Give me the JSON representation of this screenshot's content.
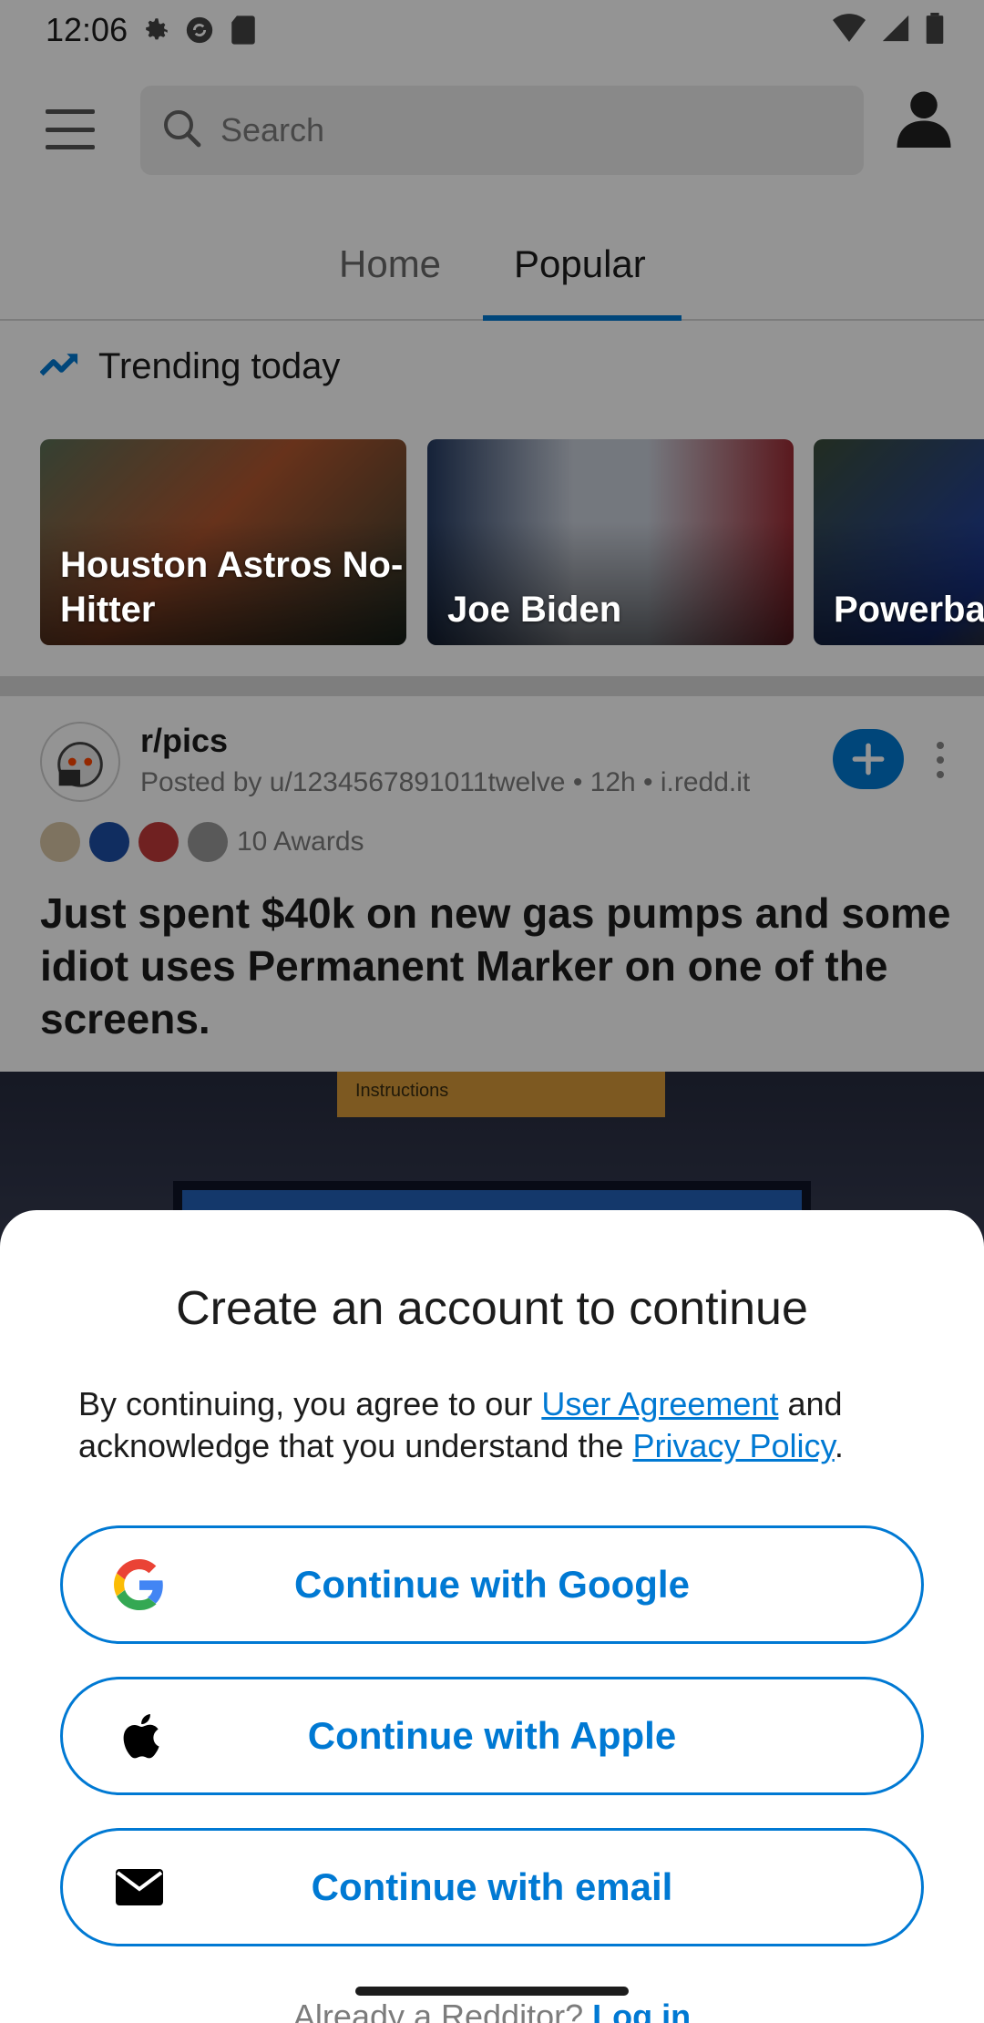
{
  "status_bar": {
    "time": "12:06"
  },
  "header": {
    "search_placeholder": "Search"
  },
  "tabs": [
    {
      "label": "Home"
    },
    {
      "label": "Popular"
    }
  ],
  "trending": {
    "title": "Trending today",
    "cards": [
      {
        "label": "Houston Astros No-Hitter"
      },
      {
        "label": "Joe Biden"
      },
      {
        "label": "Powerba"
      }
    ]
  },
  "post": {
    "subreddit": "r/pics",
    "meta": "Posted by u/1234567891011twelve • 12h • i.redd.it",
    "awards": "10 Awards",
    "title": "Just spent $40k on new gas pumps and some idiot uses Permanent Marker on one of the screens.",
    "image_sticker": "Instructions"
  },
  "sheet": {
    "title": "Create an account to continue",
    "terms_prefix": "By continuing, you agree to our ",
    "user_agreement": "User Agreement",
    "terms_middle": " and acknowledge that you understand the ",
    "privacy_policy": "Privacy Policy",
    "terms_suffix": ".",
    "google": "Continue with Google",
    "apple": "Continue with Apple",
    "email": "Continue with email",
    "already": "Already a Redditor? ",
    "login": "Log in"
  },
  "colors": {
    "accent": "#0079d3"
  }
}
